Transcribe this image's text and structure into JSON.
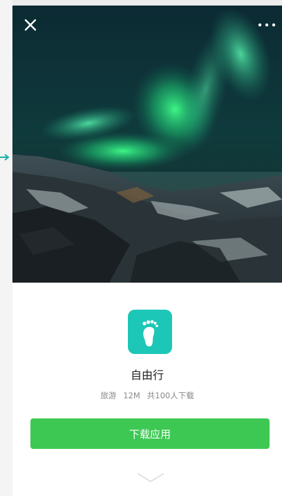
{
  "header": {
    "close_icon": "close-icon",
    "more_icon": "more-dots-icon"
  },
  "app": {
    "name": "自由行",
    "category": "旅游",
    "size": "12M",
    "downloads": "共100人下载",
    "icon": "footprint-icon",
    "icon_color": "#1cc7b7"
  },
  "actions": {
    "download_label": "下载应用",
    "button_color": "#3dc853"
  },
  "footer": {
    "expand_icon": "chevron-down-icon"
  }
}
